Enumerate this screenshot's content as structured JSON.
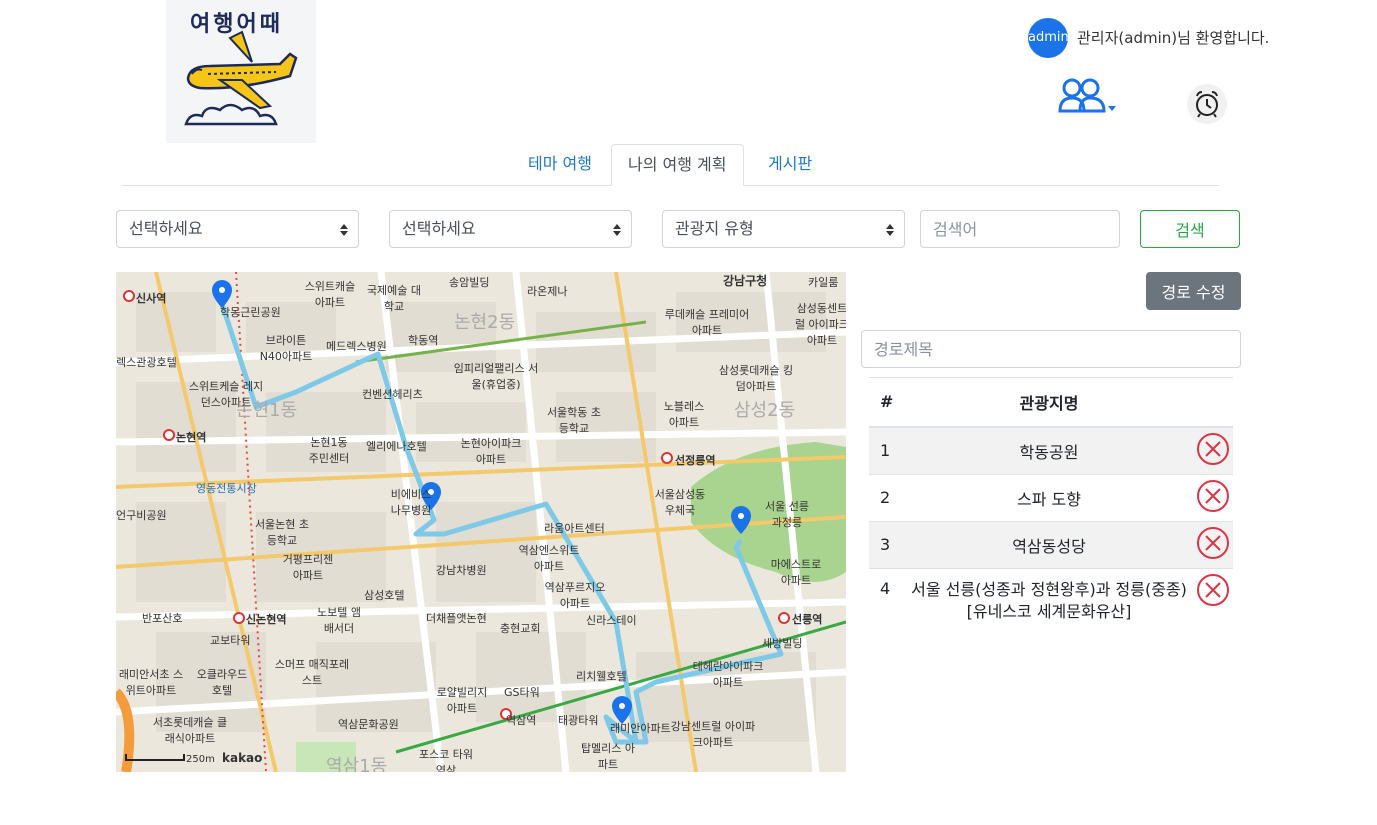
{
  "logo": {
    "text": "여행어때",
    "icon": "airplane-logo-icon"
  },
  "user": {
    "avatar_text": "admin",
    "welcome": "관리자(admin)님 환영합니다."
  },
  "header": {
    "users_icon": "users-icon",
    "alarm_icon": "alarm-clock-icon"
  },
  "tabs": [
    {
      "label": "테마 여행",
      "active": false
    },
    {
      "label": "나의 여행 계획",
      "active": true
    },
    {
      "label": "게시판",
      "active": false
    }
  ],
  "filters": {
    "select1": "선택하세요",
    "select2": "선택하세요",
    "select3": "관광지 유형",
    "search_placeholder": "검색어",
    "search_button": "검색"
  },
  "map": {
    "provider": "kakao",
    "scale": "250m",
    "labels": [
      "신사역",
      "학동근린공원",
      "스위트캐슬 아파트",
      "국제예술 대학교",
      "송암빌딩",
      "라온제나",
      "강남구청",
      "카일룸",
      "렉스관광호텔",
      "브라이튼 N40아파트",
      "메드렉스병원",
      "학동역",
      "논현2동",
      "임피리얼팰리스 서울(휴업중)",
      "루데캐슬 프레미어아파트",
      "삼성동센트럴 아이파크아파트",
      "스위트케슬 레지던스아파트",
      "논현1동",
      "컨벤션헤리츠",
      "서울학동 초등학교",
      "노블레스 아파트",
      "삼성2동",
      "삼성롯데캐슬 킹덤아파트",
      "논현역",
      "논현1동 주민센터",
      "엘리에나호텔",
      "논현아이파크 아파트",
      "선정릉역",
      "영동전통시장",
      "비에비스 나무병원",
      "서울삼성동 우체국",
      "서울 선릉과정릉",
      "언구비공원",
      "서울논현 초등학교",
      "라움아트센터",
      "거평프리젠 아파트",
      "역삼엔스위트 아파트",
      "강남차병원",
      "마에스트로 아파트",
      "삼성호텔",
      "역삼푸르지오 아파트",
      "반포산호",
      "신논현역",
      "노보텔 앰배서더",
      "더채플앳논현",
      "충현교회",
      "신라스테이",
      "선릉역",
      "교보타워",
      "세방빌딩",
      "래미안서초 스위트아파트",
      "오클라우드 호텔",
      "스머프 매직포레스트",
      "리치웰호텔",
      "테헤란아이파크 아파트",
      "로얄빌리지 아파트",
      "GS타워",
      "서초롯데캐슬 클래식아파트",
      "역삼문화공원",
      "역삼역",
      "태광타워",
      "래미안아파트",
      "강남센트럴 아이파크아파트",
      "포스코 타워역삼",
      "탑멜리스 아파트",
      "역삼1동"
    ]
  },
  "route_panel": {
    "edit_button": "경로 수정",
    "title_placeholder": "경로제목",
    "columns": [
      "#",
      "관광지명"
    ],
    "rows": [
      {
        "num": "1",
        "name": "학동공원"
      },
      {
        "num": "2",
        "name": "스파 도향"
      },
      {
        "num": "3",
        "name": "역삼동성당"
      },
      {
        "num": "4",
        "name": "서울 선릉(성종과 정현왕후)과 정릉(중종) [유네스코 세계문화유산]"
      }
    ],
    "delete_icon": "delete-circle-x-icon",
    "colors": {
      "delete": "#dc3545",
      "route": "#7ec8e8",
      "marker": "#1a73e8"
    }
  }
}
